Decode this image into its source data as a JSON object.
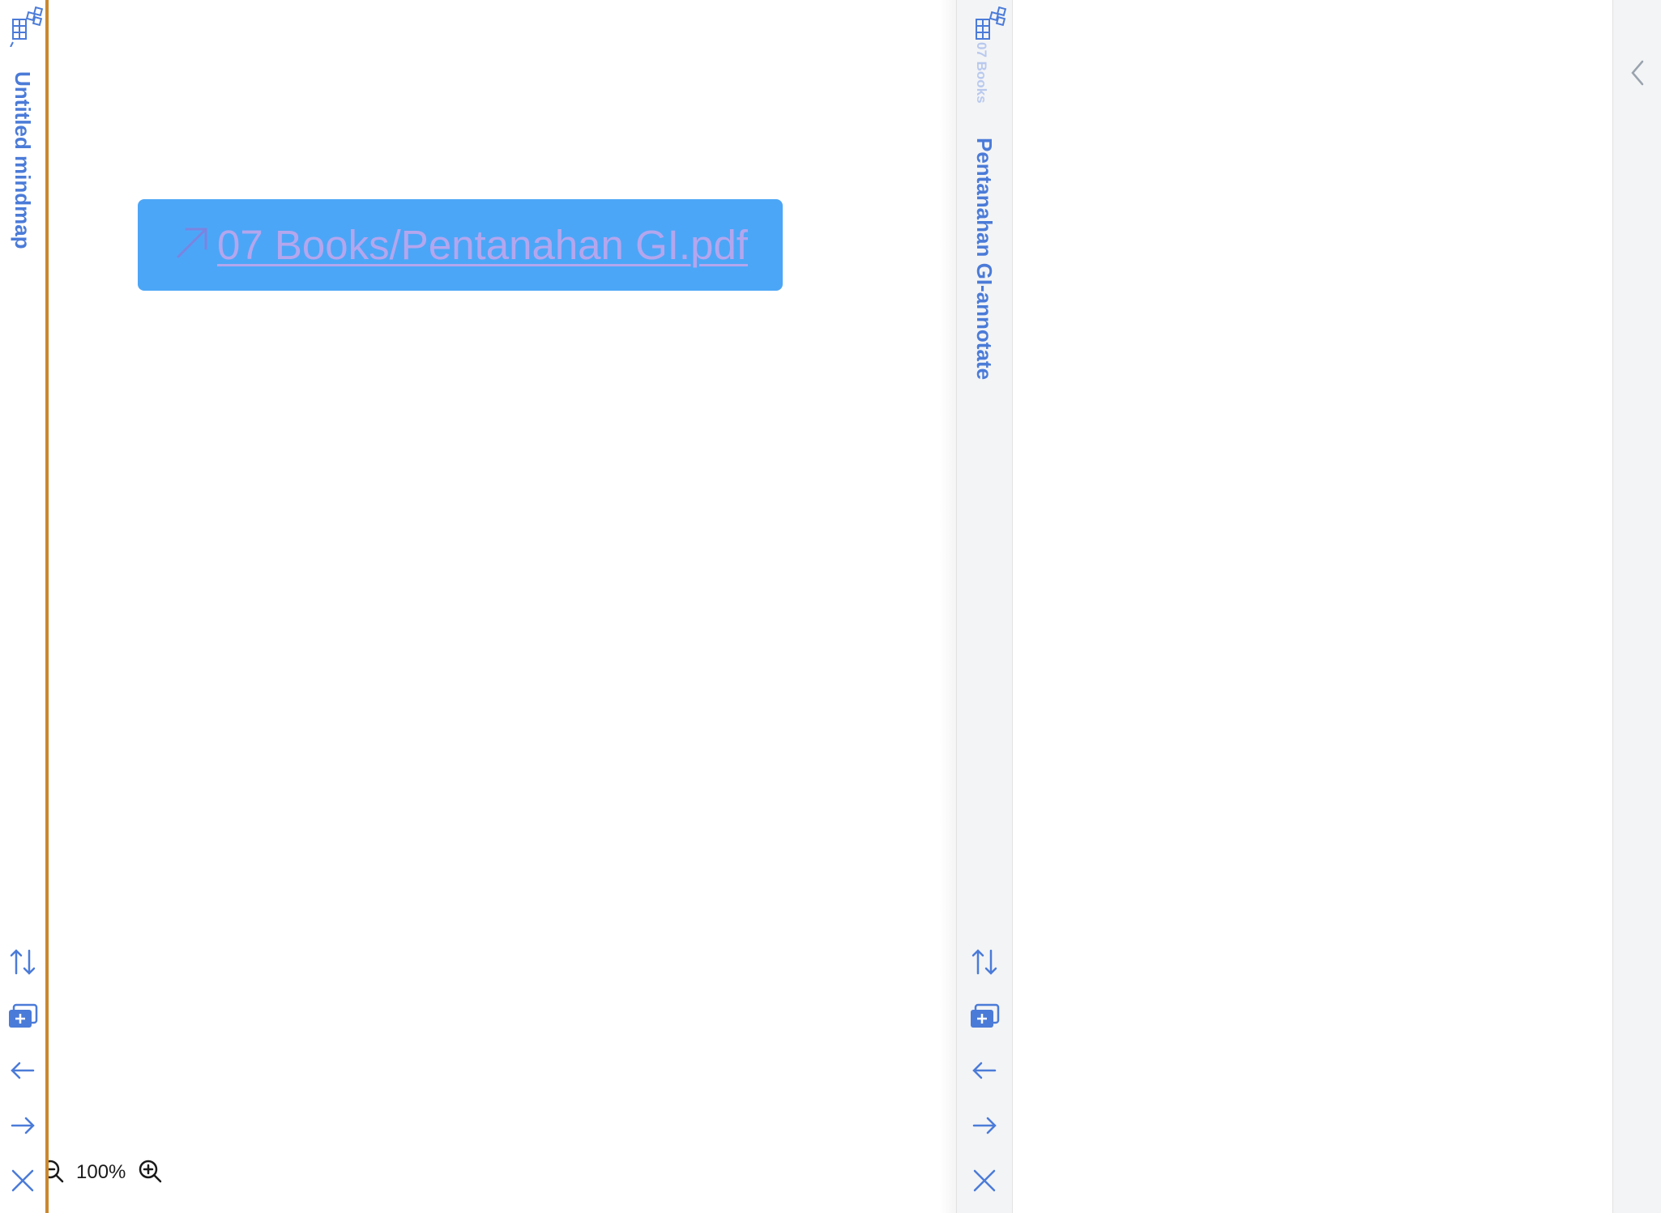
{
  "left_pane": {
    "tab_title": "Untitled mindmap",
    "icon_names": [
      "mindmap-icon",
      "swap-vertical-icon",
      "new-tab-icon",
      "arrow-left-icon",
      "arrow-right-icon",
      "close-icon"
    ]
  },
  "mindmap": {
    "node_link": "07 Books/Pentanahan GI.pdf",
    "node_icon": "external-link-arrow-icon",
    "node_color": "#4ca6f7",
    "link_color": "#b4a6ee"
  },
  "zoom": {
    "level": "100%"
  },
  "right_pane": {
    "folder_label": "07 Books",
    "tab_title": "Pentanahan GI-annotate",
    "icon_names": [
      "mindmap-icon",
      "swap-vertical-icon",
      "new-tab-icon",
      "arrow-left-icon",
      "arrow-right-icon",
      "close-icon"
    ],
    "collapse_icon": "chevron-left-icon"
  },
  "colors": {
    "accent": "#4b7bd8",
    "active_border": "#c9882f",
    "strip_background": "#f3f4f6"
  }
}
